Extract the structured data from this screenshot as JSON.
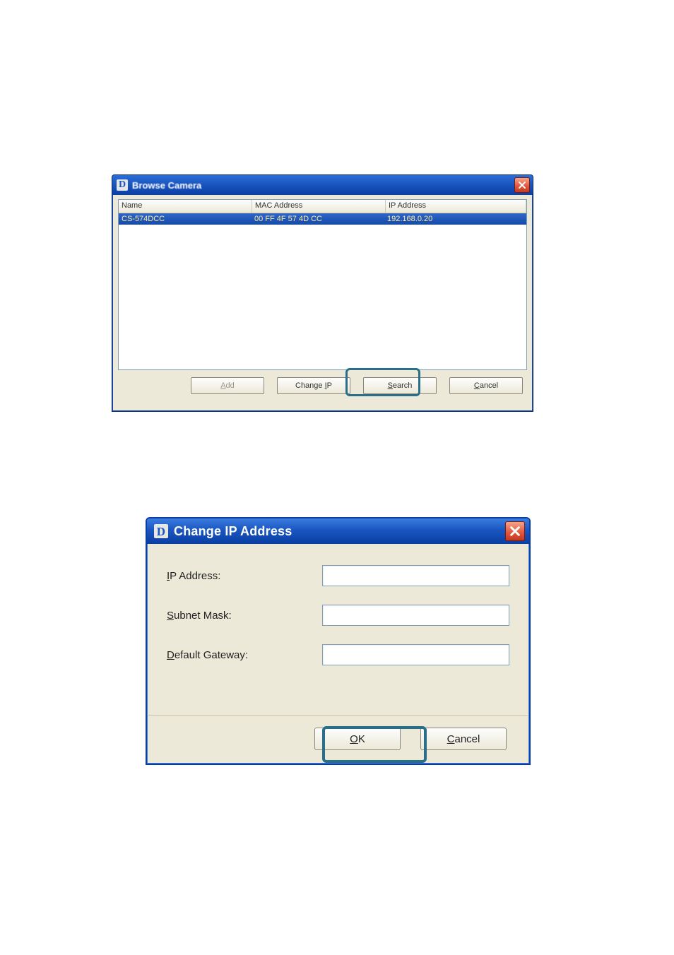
{
  "browse": {
    "title": "Browse Camera",
    "icon_letter": "D",
    "columns": {
      "name": "Name",
      "mac": "MAC Address",
      "ip": "IP Address"
    },
    "rows": [
      {
        "name": "CS-574DCC",
        "mac": "00 FF 4F 57 4D CC",
        "ip": "192.168.0.20",
        "selected": true
      }
    ],
    "buttons": {
      "add": "Add",
      "change_ip": "Change IP",
      "search": "Search",
      "cancel": "Cancel"
    }
  },
  "change_ip": {
    "title": "Change IP Address",
    "icon_letter": "D",
    "labels": {
      "ip": "IP Address:",
      "subnet": "Subnet Mask:",
      "gateway": "Default Gateway:"
    },
    "values": {
      "ip": "",
      "subnet": "",
      "gateway": ""
    },
    "buttons": {
      "ok": "OK",
      "cancel": "Cancel"
    }
  }
}
